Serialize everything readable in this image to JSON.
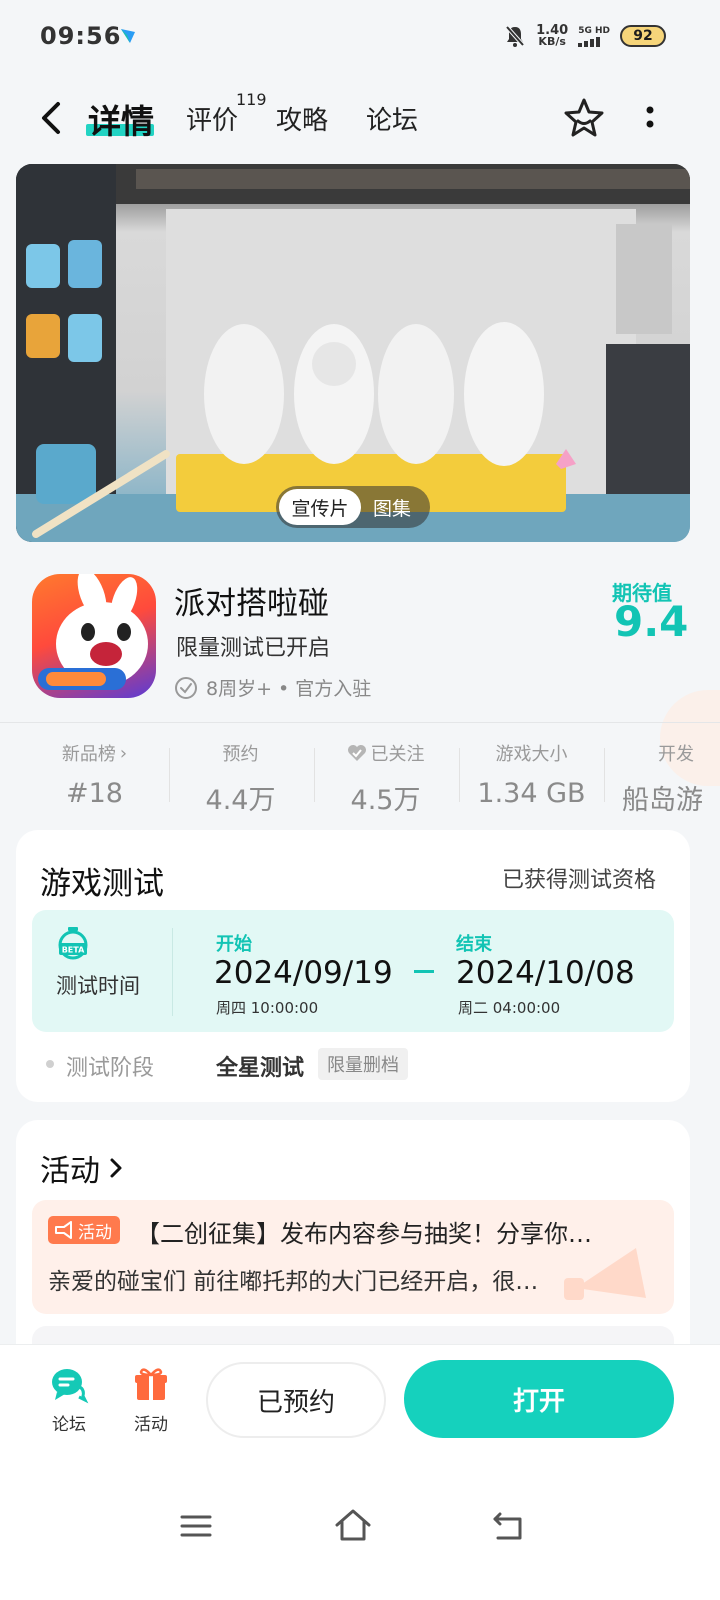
{
  "status_bar": {
    "time": "09:56",
    "net_speed_value": "1.40",
    "net_speed_unit": "KB/s",
    "network": "5G HD",
    "battery": "92"
  },
  "header": {
    "tabs": [
      {
        "label": "详情",
        "active": true
      },
      {
        "label": "评价",
        "count": "119"
      },
      {
        "label": "攻略"
      },
      {
        "label": "论坛"
      }
    ]
  },
  "banner": {
    "toggle_active": "宣传片",
    "toggle_inactive": "图集"
  },
  "app": {
    "name": "派对搭啦碰",
    "tagline": "限量测试已开启",
    "meta": "8周岁+ • 官方入驻",
    "expect_label": "期待值",
    "expect_score": "9.4"
  },
  "stats": [
    {
      "label": "新品榜",
      "value": "#18"
    },
    {
      "label": "预约",
      "value": "4.4万"
    },
    {
      "label": "已关注",
      "value": "4.5万"
    },
    {
      "label": "游戏大小",
      "value": "1.34 GB"
    },
    {
      "label": "开发",
      "value": "船岛游"
    }
  ],
  "game_test": {
    "title": "游戏测试",
    "status": "已获得测试资格",
    "badge": "BETA",
    "time_label": "测试时间",
    "start_label": "开始",
    "start_date": "2024/09/19",
    "start_time": "周四  10:00:00",
    "end_label": "结束",
    "end_date": "2024/10/08",
    "end_time": "周二  04:00:00",
    "phase_label": "测试阶段",
    "phase_value": "全星测试",
    "phase_tag": "限量删档"
  },
  "activity": {
    "title": "活动",
    "badge": "活动",
    "headline": "【二创征集】发布内容参与抽奖！分享你…",
    "desc": "亲爱的碰宝们 前往嘟托邦的大门已经开启，很…"
  },
  "bottom_bar": {
    "forum_label": "论坛",
    "activity_label": "活动",
    "reserved_label": "已预约",
    "open_label": "打开"
  },
  "colors": {
    "accent": "#15d1bd",
    "activity_orange": "#ff7a4d"
  }
}
